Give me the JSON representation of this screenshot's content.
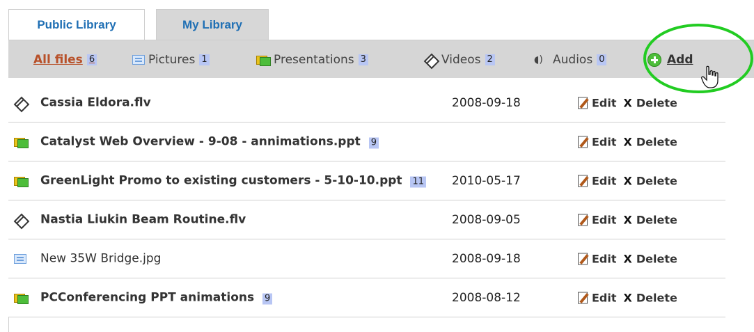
{
  "tabs": [
    {
      "label": "Public Library",
      "active": true
    },
    {
      "label": "My Library",
      "active": false
    }
  ],
  "filters": {
    "all": {
      "label": "All files",
      "count": "6"
    },
    "pictures": {
      "label": "Pictures",
      "count": "1",
      "icon": "picture-icon"
    },
    "presentations": {
      "label": "Presentations",
      "count": "3",
      "icon": "presentation-icon"
    },
    "videos": {
      "label": "Videos",
      "count": "2",
      "icon": "video-icon"
    },
    "audios": {
      "label": "Audios",
      "count": "0",
      "icon": "audio-icon"
    },
    "add": {
      "label": "Add",
      "icon": "plus-circle-icon"
    }
  },
  "actions": {
    "edit_label": "Edit",
    "delete_label": "Delete"
  },
  "files": [
    {
      "name": "Cassia Eldora.flv",
      "count": "",
      "date": "2008-09-18",
      "type": "video"
    },
    {
      "name": "Catalyst Web Overview - 9-08 - annimations.ppt",
      "count": "9",
      "date": "",
      "type": "presentation"
    },
    {
      "name": "GreenLight Promo to existing customers - 5-10-10.ppt",
      "count": "11",
      "date": "2010-05-17",
      "type": "presentation"
    },
    {
      "name": "Nastia Liukin Beam Routine.flv",
      "count": "",
      "date": "2008-09-05",
      "type": "video"
    },
    {
      "name": "New 35W Bridge.jpg",
      "count": "",
      "date": "2008-09-18",
      "type": "picture"
    },
    {
      "name": "PCConferencing PPT animations",
      "count": "9",
      "date": "2008-08-12",
      "type": "presentation"
    }
  ],
  "colors": {
    "tab_text": "#1f6fb4",
    "filter_bar": "#d6d6d6",
    "all_files_text": "#b8512a",
    "count_badge": "#b8c6f4",
    "highlight_circle": "#22cc22"
  }
}
